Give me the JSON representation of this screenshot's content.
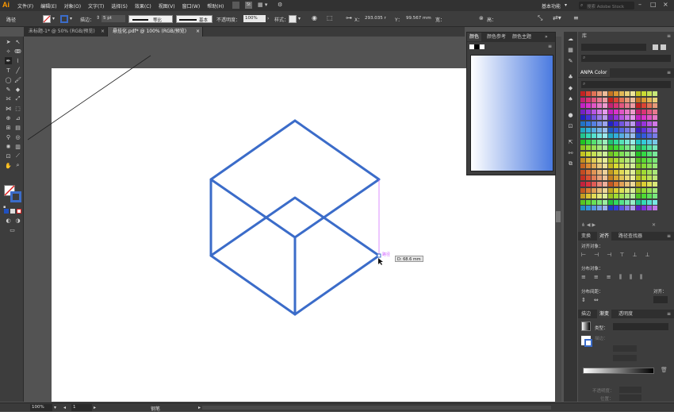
{
  "app": {
    "logo": "Ai",
    "workspace": "基本功能",
    "search_placeholder": "搜索 Adobe Stock",
    "doc_mode": "St"
  },
  "menu": [
    "文件(F)",
    "编辑(E)",
    "对象(O)",
    "文字(T)",
    "选择(S)",
    "效果(C)",
    "视图(V)",
    "窗口(W)",
    "帮助(H)"
  ],
  "control": {
    "context": "路径",
    "stroke_label": "描边：",
    "stroke_value": "5 pt",
    "profile_label": "等比",
    "brush_label": "基本",
    "opacity_label": "不透明度：",
    "opacity_value": "100%",
    "style_label": "样式：",
    "x_label": "X：",
    "x_value": "293.035 r",
    "y_label": "Y：",
    "y_value": "99.567 mm",
    "w_label": "宽：",
    "w_value": " ",
    "h_label": "高：",
    "h_value": " "
  },
  "tabs": [
    {
      "label": "未标题-1* @ 50% (RGB/预览)",
      "close": "×",
      "active": false
    },
    {
      "label": "悬挂化.pdf* @ 100% (RGB/预览)",
      "close": "×",
      "active": true
    }
  ],
  "color_panel": {
    "tabs": [
      "颜色",
      "颜色参考",
      "颜色主题"
    ],
    "menu_icon": "≡",
    "collapse": "»"
  },
  "library_panel": {
    "title": "库",
    "swatch_panel": "ANPA Color"
  },
  "align_panel": {
    "tabs": [
      "变换",
      "对齐",
      "路径查找器"
    ],
    "align_objects": "对齐对象：",
    "distribute_objects": "分布对象：",
    "distribute_spacing": "分布间距：",
    "align_to": "对齐："
  },
  "gradient_panel": {
    "tabs": [
      "描边",
      "渐变",
      "透明度"
    ],
    "type_label": "类型：",
    "stroke_label": "描边：",
    "opacity_label": "不透明度：",
    "position_label": "位置："
  },
  "tooltip": "D: 68.6 mm",
  "anchor_label": "路径",
  "status": {
    "zoom": "100%",
    "page": "1",
    "tool": "钢笔"
  },
  "colors": {
    "accent": "#4a7ae0",
    "cube_stroke": "#3b6cc9",
    "ui_dark": "#323232",
    "ui_mid": "#3d3d3d",
    "canvas": "#535353"
  }
}
